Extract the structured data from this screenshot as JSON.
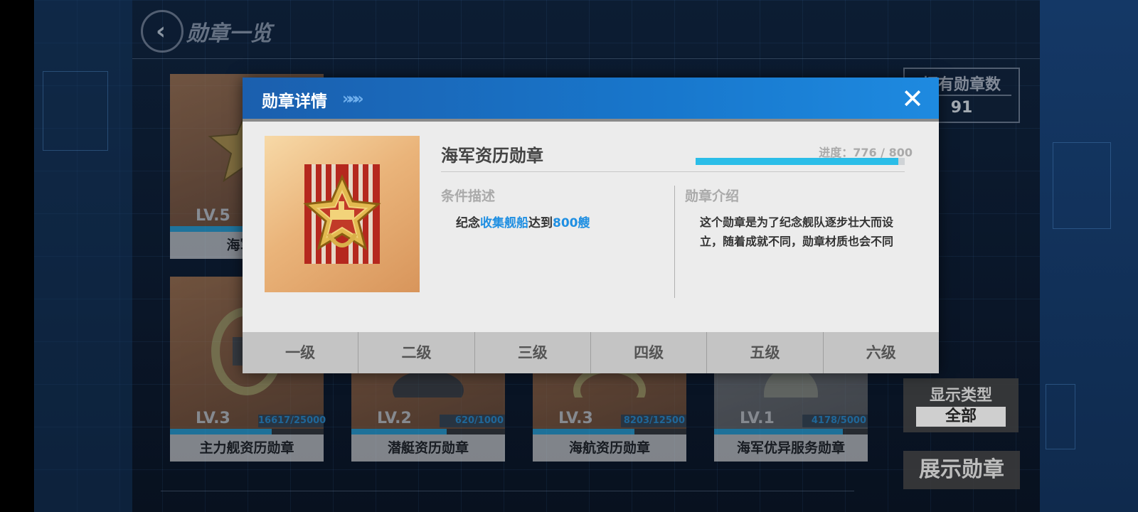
{
  "screen": {
    "title": "勋章一览"
  },
  "owned": {
    "label": "拥有勋章数",
    "value": "91"
  },
  "filter": {
    "label": "显示类型",
    "selected": "全部"
  },
  "show_button": "展示勋章",
  "background_cards": [
    {
      "level": "LV.5",
      "name": "海军资",
      "progress_text": ""
    },
    {
      "level": "LV.3",
      "name": "主力舰资历勋章",
      "progress_text": "16617/25000",
      "progress": 0.66
    },
    {
      "level": "LV.2",
      "name": "潜艇资历勋章",
      "progress_text": "620/1000",
      "progress": 0.62
    },
    {
      "level": "LV.3",
      "name": "海航资历勋章",
      "progress_text": "8203/12500",
      "progress": 0.66
    },
    {
      "level": "LV.1",
      "name": "海军优异服务勋章",
      "progress_text": "4178/5000",
      "progress": 0.84
    }
  ],
  "modal": {
    "title": "勋章详情",
    "close_icon": "close-icon",
    "medal_name": "海军资历勋章",
    "progress_text": "进度：776 / 800",
    "progress": 0.97,
    "condition_label": "条件描述",
    "condition": {
      "prefix": "纪念",
      "highlight1": "收集舰船",
      "mid": "达到",
      "highlight2": "800艘"
    },
    "intro_label": "勋章介绍",
    "intro_text": "这个勋章是为了纪念舰队逐步壮大而设立，随着成就不同，勋章材质也会不同",
    "tabs": [
      "一级",
      "二级",
      "三级",
      "四级",
      "五级",
      "六级"
    ]
  },
  "colors": {
    "accent": "#1f8fe2",
    "header": "#1877cc",
    "progress": "#2bbde8"
  }
}
